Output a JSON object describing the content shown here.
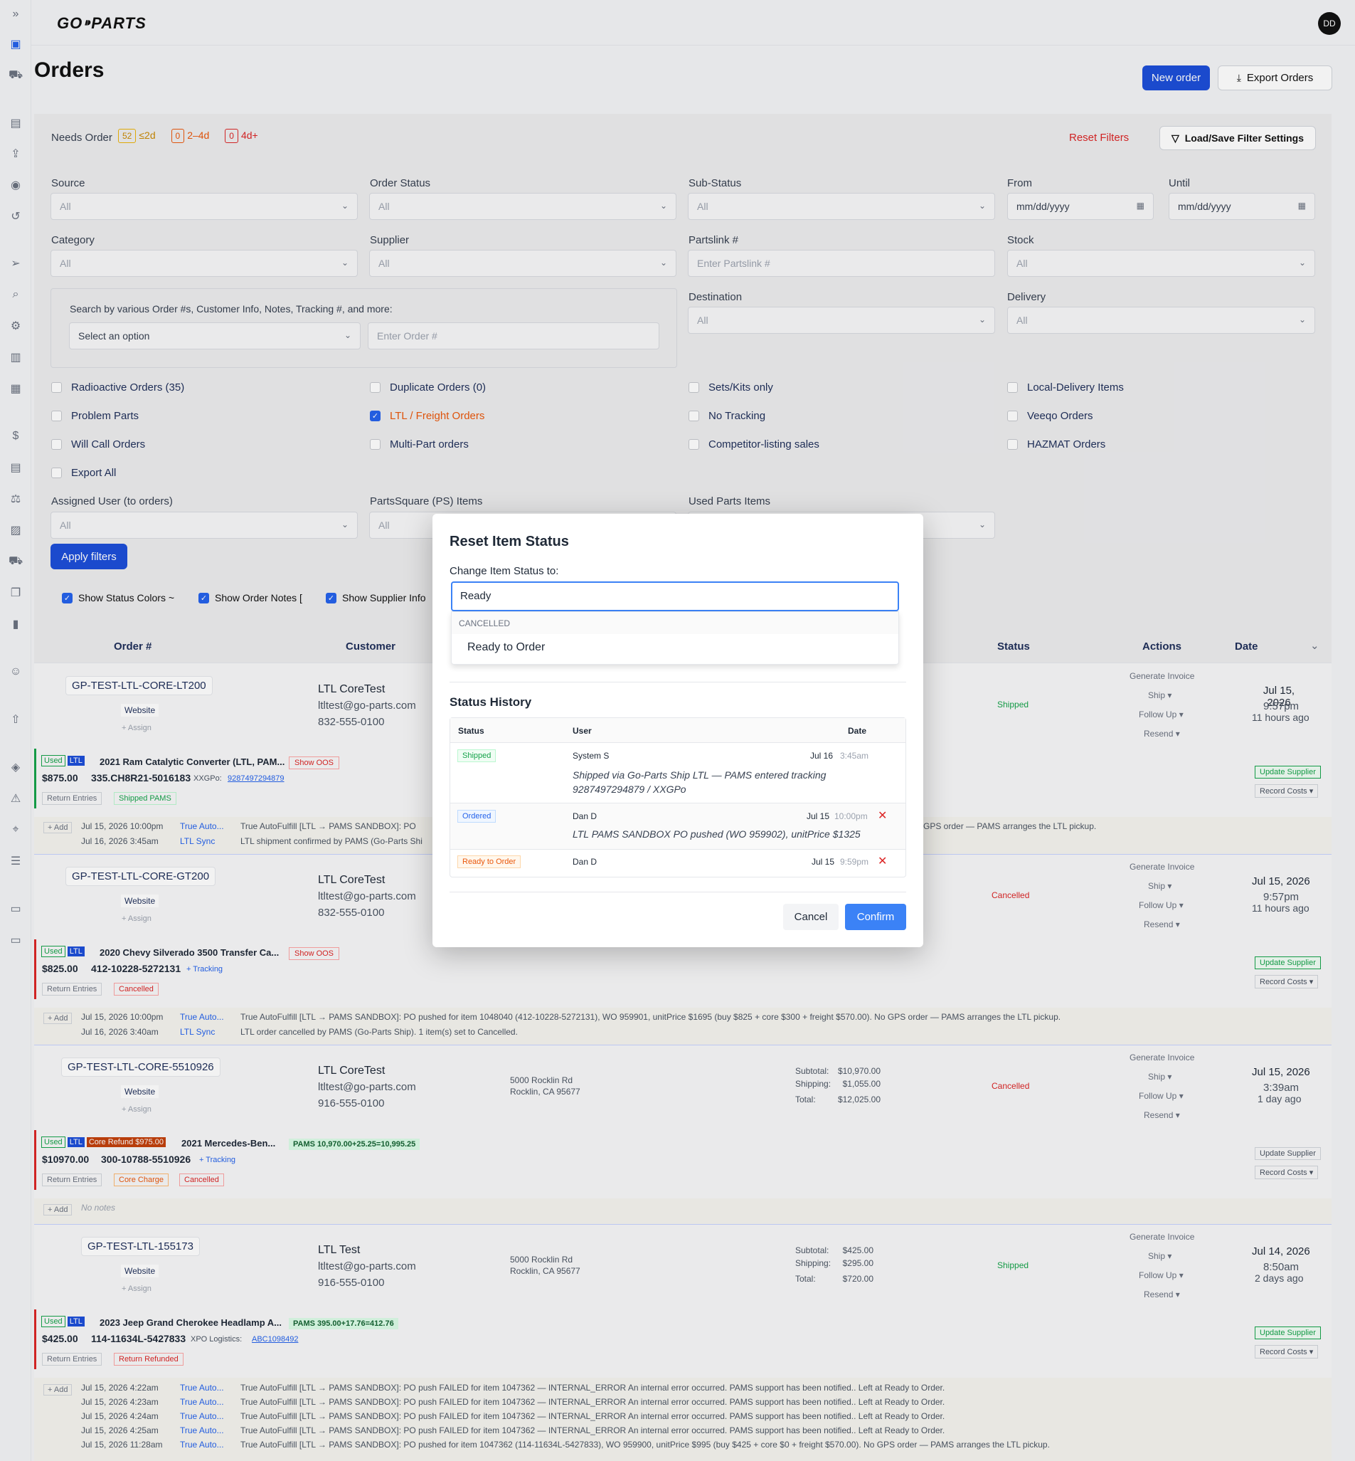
{
  "app": {
    "logo": "GO⁍PARTS",
    "avatar": "DD"
  },
  "page": {
    "title": "Orders",
    "new_order": "New order",
    "export_orders": "Export Orders"
  },
  "filters": {
    "needs_order": "Needs Order",
    "n1": "52",
    "n1_label": "≤2d",
    "n2": "0",
    "n2_label": "2–4d",
    "n3": "0",
    "n3_label": "4d+",
    "reset": "Reset Filters",
    "load_save": "Load/Save Filter Settings",
    "source": "Source",
    "order_status": "Order Status",
    "sub_status": "Sub-Status",
    "from": "From",
    "until": "Until",
    "category": "Category",
    "supplier": "Supplier",
    "partslink": "Partslink #",
    "stock": "Stock",
    "all": "All",
    "date_ph": "mm/dd/yyyy",
    "partslink_ph": "Enter Partslink #",
    "search_help": "Search by various Order #s, Customer Info, Notes, Tracking #, and more:",
    "select_option": "Select an option",
    "order_ph": "Enter Order #",
    "destination": "Destination",
    "delivery": "Delivery",
    "checks": [
      {
        "label": "Radioactive Orders (35)",
        "on": false
      },
      {
        "label": "Duplicate Orders (0)",
        "on": false
      },
      {
        "label": "Sets/Kits only",
        "on": false
      },
      {
        "label": "Local-Delivery Items",
        "on": false
      },
      {
        "label": "Problem Parts",
        "on": false
      },
      {
        "label": "LTL / Freight Orders",
        "on": true
      },
      {
        "label": "No Tracking",
        "on": false
      },
      {
        "label": "Veeqo Orders",
        "on": false
      },
      {
        "label": "Will Call Orders",
        "on": false
      },
      {
        "label": "Multi-Part orders",
        "on": false
      },
      {
        "label": "Competitor-listing sales",
        "on": false
      },
      {
        "label": "HAZMAT Orders",
        "on": false
      },
      {
        "label": "Export All",
        "on": false
      }
    ],
    "assigned_user": "Assigned User (to orders)",
    "partssquare": "PartsSquare (PS) Items",
    "used_parts": "Used Parts Items",
    "apply": "Apply filters",
    "show_status_colors": "Show Status Colors ~",
    "show_order_notes": "Show Order Notes [",
    "show_supplier_info": "Show Supplier Info"
  },
  "table": {
    "headers": {
      "order": "Order #",
      "customer": "Customer",
      "status": "Status",
      "actions": "Actions",
      "date": "Date"
    }
  },
  "actions": {
    "generate_invoice": "Generate Invoice",
    "ship": "Ship",
    "follow_up": "Follow Up",
    "resend": "Resend",
    "update_supplier": "Update Supplier",
    "record_costs": "Record Costs",
    "return_entries": "Return Entries",
    "add": "+ Add",
    "assign": "+ Assign",
    "website": "Website",
    "show_oos": "Show OOS",
    "tracking": "+ Tracking",
    "used": "Used",
    "ltl": "LTL"
  },
  "orders": [
    {
      "id": "GP-TEST-LTL-CORE-LT200",
      "cust": "LTL CoreTest",
      "email": "ltltest@go-parts.com",
      "phone": "832-555-0100",
      "status": "Shipped",
      "date": "Jul 15, 2026",
      "time": "9:57pm",
      "ago": "11 hours ago",
      "item": "2021 Ram Catalytic Converter (LTL, PAM...",
      "price": "$875.00",
      "pn": "335.CH8R21-5016183",
      "xx": "XXGPo:",
      "xxnum": "9287497294879",
      "tag": "Shipped PAMS",
      "n1d": "Jul 15, 2026  10:00pm",
      "n1u": "True Auto...",
      "n1t": "True AutoFulfill [LTL → PAMS SANDBOX]: PO",
      "n1e": "GPS order — PAMS arranges the LTL pickup.",
      "n2d": "Jul 16, 2026  3:45am",
      "n2u": "LTL Sync",
      "n2t": "LTL shipment confirmed by PAMS (Go-Parts Shi"
    },
    {
      "id": "GP-TEST-LTL-CORE-GT200",
      "cust": "LTL CoreTest",
      "email": "ltltest@go-parts.com",
      "phone": "832-555-0100",
      "status": "Cancelled",
      "date": "Jul 15, 2026",
      "time": "9:57pm",
      "ago": "11 hours ago",
      "item": "2020 Chevy Silverado 3500 Transfer Ca...",
      "price": "$825.00",
      "pn": "412-10228-5272131",
      "tag": "Cancelled",
      "n1d": "Jul 15, 2026  10:00pm",
      "n1u": "True Auto...",
      "n1t": "True AutoFulfill [LTL → PAMS SANDBOX]: PO pushed for item 1048040 (412-10228-5272131), WO 959901, unitPrice $1695 (buy $825 + core $300 + freight $570.00). No GPS order — PAMS arranges the LTL pickup.",
      "n2d": "Jul 16, 2026  3:40am",
      "n2u": "LTL Sync",
      "n2t": "LTL order cancelled by PAMS (Go-Parts Ship). 1 item(s) set to Cancelled."
    },
    {
      "id": "GP-TEST-LTL-CORE-5510926",
      "cust": "LTL CoreTest",
      "email": "ltltest@go-parts.com",
      "phone": "916-555-0100",
      "addr1": "5000 Rocklin Rd",
      "addr2": "Rocklin, CA 95677",
      "sub": "Subtotal:",
      "subv": "$10,970.00",
      "ship": "Shipping:",
      "shipv": "$1,055.00",
      "tot": "Total:",
      "totv": "$12,025.00",
      "status": "Cancelled",
      "date": "Jul 15, 2026",
      "time": "3:39am",
      "ago": "1 day ago",
      "core": "Core Refund $975.00",
      "item": "2021 Mercedes-Ben...",
      "pams": "PAMS 10,970.00+25.25=10,995.25",
      "price": "$10970.00",
      "pn": "300-10788-5510926",
      "tag1": "Core Charge",
      "tag": "Cancelled",
      "nonote": "No notes"
    },
    {
      "id": "GP-TEST-LTL-155173",
      "cust": "LTL Test",
      "email": "ltltest@go-parts.com",
      "phone": "916-555-0100",
      "addr1": "5000 Rocklin Rd",
      "addr2": "Rocklin, CA 95677",
      "sub": "Subtotal:",
      "subv": "$425.00",
      "ship": "Shipping:",
      "shipv": "$295.00",
      "tot": "Total:",
      "totv": "$720.00",
      "status": "Shipped",
      "date": "Jul 14, 2026",
      "time": "8:50am",
      "ago": "2 days ago",
      "item": "2023 Jeep Grand Cherokee Headlamp A...",
      "pams": "PAMS 395.00+17.76=412.76",
      "price": "$425.00",
      "pn": "114-11634L-5427833",
      "xx": "XPO Logistics:",
      "xxnum": "ABC1098492",
      "tag": "Return Refunded"
    }
  ],
  "order4_notes": [
    {
      "d": "Jul 15, 2026  4:22am",
      "u": "True Auto...",
      "t": "True AutoFulfill [LTL → PAMS SANDBOX]: PO push FAILED for item 1047362 — INTERNAL_ERROR An internal error occurred. PAMS support has been notified.. Left at Ready to Order."
    },
    {
      "d": "Jul 15, 2026  4:23am",
      "u": "True Auto...",
      "t": "True AutoFulfill [LTL → PAMS SANDBOX]: PO push FAILED for item 1047362 — INTERNAL_ERROR An internal error occurred. PAMS support has been notified.. Left at Ready to Order."
    },
    {
      "d": "Jul 15, 2026  4:24am",
      "u": "True Auto...",
      "t": "True AutoFulfill [LTL → PAMS SANDBOX]: PO push FAILED for item 1047362 — INTERNAL_ERROR An internal error occurred. PAMS support has been notified.. Left at Ready to Order."
    },
    {
      "d": "Jul 15, 2026  4:25am",
      "u": "True Auto...",
      "t": "True AutoFulfill [LTL → PAMS SANDBOX]: PO push FAILED for item 1047362 — INTERNAL_ERROR An internal error occurred. PAMS support has been notified.. Left at Ready to Order."
    },
    {
      "d": "Jul 15, 2026  11:28am",
      "u": "True Auto...",
      "t": "True AutoFulfill [LTL → PAMS SANDBOX]: PO pushed for item 1047362 (114-11634L-5427833), WO 959900, unitPrice $995 (buy $425 + core $0 + freight $570.00). No GPS order — PAMS arranges the LTL pickup."
    }
  ],
  "modal": {
    "title": "Reset Item Status",
    "change_label": "Change Item Status to:",
    "input_value": "Ready",
    "group": "CANCELLED",
    "option": "Ready to Order",
    "history_title": "Status History",
    "col_status": "Status",
    "col_user": "User",
    "col_date": "Date",
    "history": [
      {
        "status": "Shipped",
        "user": "System S",
        "date": "Jul 16",
        "time": "3:45am",
        "note": "Shipped via Go-Parts Ship LTL — PAMS entered tracking 9287497294879 / XXGPo",
        "color": "#16a34a",
        "bg": "#f0fdf4"
      },
      {
        "status": "Ordered",
        "user": "Dan D",
        "date": "Jul 15",
        "time": "10:00pm",
        "note": "LTL PAMS SANDBOX PO pushed (WO 959902), unitPrice $1325",
        "color": "#2563eb",
        "bg": "#eff6ff"
      },
      {
        "status": "Ready to Order",
        "user": "Dan D",
        "date": "Jul 15",
        "time": "9:59pm",
        "note": "",
        "color": "#ea580c",
        "bg": "#fff7ed"
      }
    ],
    "cancel": "Cancel",
    "confirm": "Confirm"
  }
}
